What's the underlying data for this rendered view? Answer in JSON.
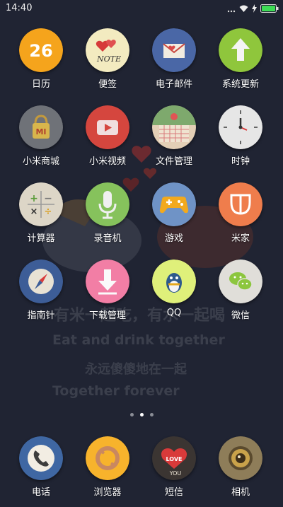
{
  "status_bar": {
    "time": "14:40",
    "icons": [
      "more-dots-icon",
      "wifi-icon",
      "charging-icon",
      "battery-icon"
    ]
  },
  "wallpaper": {
    "line1": "有米一起吃，有水一起喝",
    "line2": "Eat and drink together",
    "line3": "永远傻傻地在一起",
    "line4": "Together forever"
  },
  "apps": [
    {
      "label": "日历",
      "icon": "calendar-icon",
      "badge": "26"
    },
    {
      "label": "便签",
      "icon": "notes-icon",
      "badge": "NOTE"
    },
    {
      "label": "电子邮件",
      "icon": "email-icon"
    },
    {
      "label": "系统更新",
      "icon": "system-update-icon"
    },
    {
      "label": "小米商城",
      "icon": "mi-store-icon",
      "badge": "MI"
    },
    {
      "label": "小米视频",
      "icon": "mi-video-icon"
    },
    {
      "label": "文件管理",
      "icon": "file-manager-icon"
    },
    {
      "label": "时钟",
      "icon": "clock-icon"
    },
    {
      "label": "计算器",
      "icon": "calculator-icon"
    },
    {
      "label": "录音机",
      "icon": "recorder-icon"
    },
    {
      "label": "游戏",
      "icon": "games-icon"
    },
    {
      "label": "米家",
      "icon": "mi-home-icon"
    },
    {
      "label": "指南针",
      "icon": "compass-icon"
    },
    {
      "label": "下载管理",
      "icon": "download-manager-icon"
    },
    {
      "label": "QQ",
      "icon": "qq-icon"
    },
    {
      "label": "微信",
      "icon": "wechat-icon"
    }
  ],
  "page_indicator": {
    "count": 3,
    "active": 2
  },
  "dock": [
    {
      "label": "电话",
      "icon": "phone-icon"
    },
    {
      "label": "浏览器",
      "icon": "browser-icon"
    },
    {
      "label": "短信",
      "icon": "messages-icon",
      "badge_top": "LOVE",
      "badge_bottom": "YOU"
    },
    {
      "label": "相机",
      "icon": "camera-icon"
    }
  ],
  "colors": {
    "background": "#202433",
    "calendar": "#f5a41c",
    "notes": "#f3ebc0",
    "email": "#4a67a6",
    "update": "#8fc63c",
    "store": "#6f7278",
    "video": "#d5463e",
    "files": "#e3cfb6",
    "clock": "#e6e6e6",
    "calculator": "#ddd6c7",
    "recorder": "#86c25c",
    "games": "#6f93c6",
    "mihome": "#ef7d4c",
    "compass": "#3d5d97",
    "download": "#f27ea5",
    "qq": "#dff07a",
    "wechat": "#e0ded9",
    "phone": "#3f67a3",
    "browser": "#f7b32c",
    "sms": "#3b3532",
    "camera": "#8e7d59"
  }
}
